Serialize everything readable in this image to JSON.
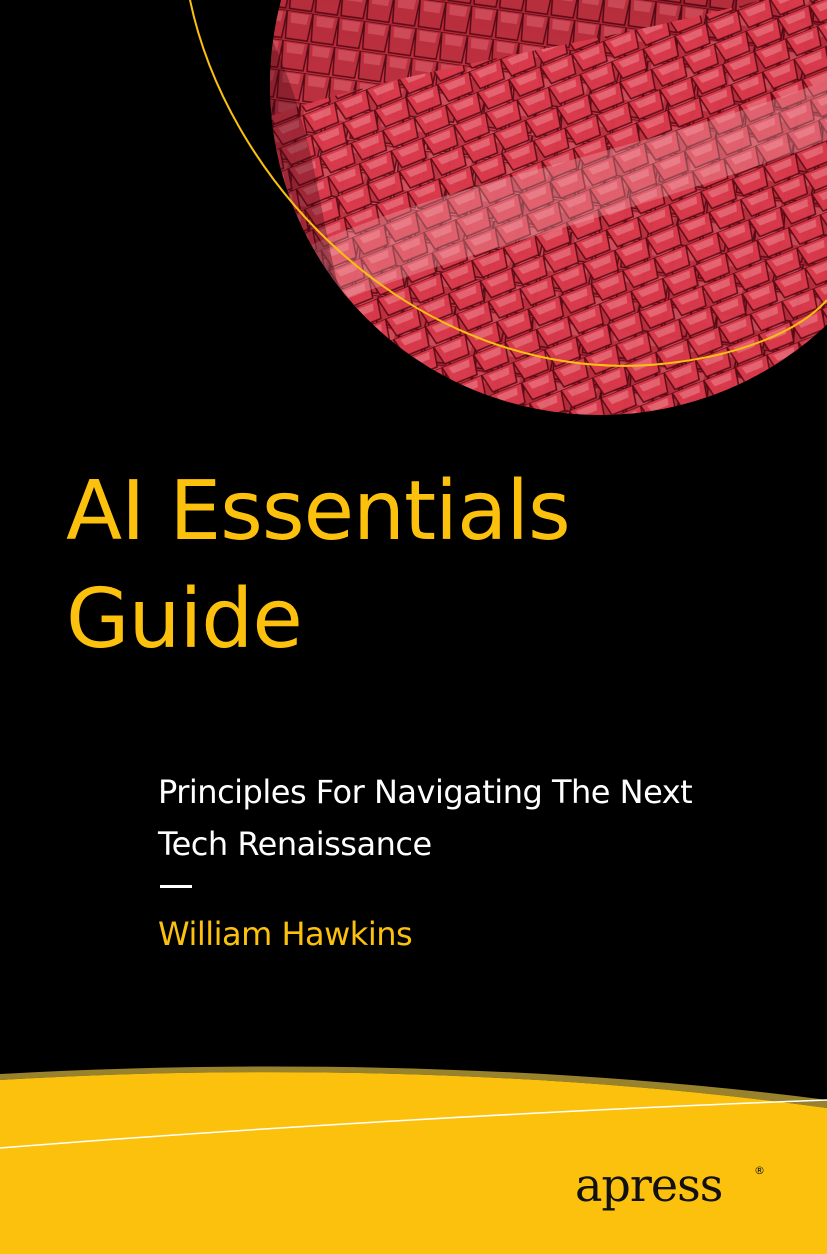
{
  "cover": {
    "title_line1": "AI Essentials",
    "title_line2": "Guide",
    "subtitle_line1": "Principles For Navigating The Next",
    "subtitle_line2": "Tech Renaissance",
    "author": "William Hawkins",
    "publisher": "apress",
    "registered_mark": "®"
  },
  "colors": {
    "background": "#000000",
    "accent_yellow": "#fcc10d",
    "art_red": "#c8283a",
    "subtitle_white": "#ffffff"
  },
  "icons": {
    "art": "red-tile-sphere-image",
    "publisher_logo": "apress-logo"
  }
}
